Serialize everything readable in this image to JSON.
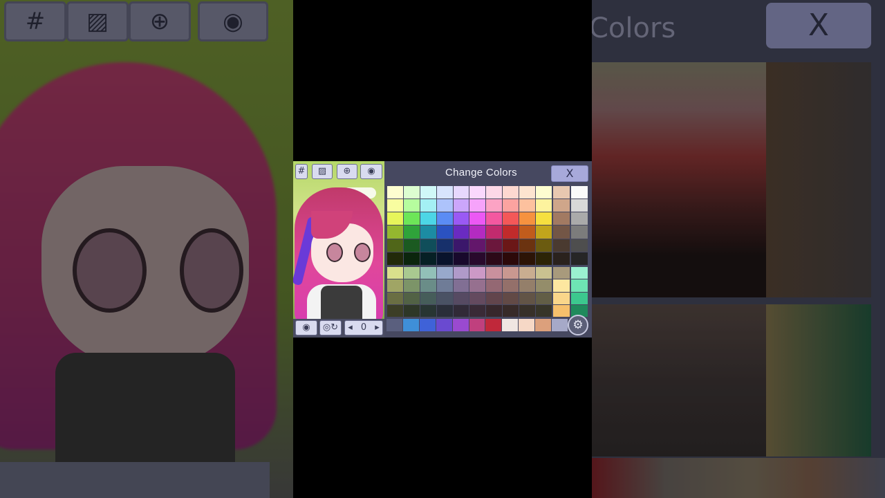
{
  "toolbar": {
    "hash_label": "#",
    "image_label": "▨",
    "zoom_label": "⊕",
    "eye_label": "◉"
  },
  "bottom_toolbar": {
    "eye_label": "◉",
    "reset_label": "◎↻",
    "prev_label": "◂",
    "next_label": "▸",
    "page_label": "0"
  },
  "panel": {
    "title": "Change Colors",
    "close_label": "X"
  },
  "gear_label": "⚙",
  "bg_right": {
    "title_fragment": "Colors",
    "close_label": "X"
  },
  "bg_left": {
    "hash_label": "#",
    "image_label": "▨",
    "zoom_label": "⊕",
    "eye_label": "◉"
  },
  "colors": {
    "accent": "#a7a9da",
    "panel_bg": "#464860",
    "title_text": "#f1f2fa"
  },
  "palette_main": [
    [
      "#fdfdd0",
      "#dcfdd0",
      "#d0f8f8",
      "#d8e4fd",
      "#e7d8fd",
      "#fad8fd",
      "#fdd8e7",
      "#fdd8d0",
      "#fde4d0",
      "#fdfdd0"
    ],
    [
      "#f8fda0",
      "#b6fd9e",
      "#a4f0f4",
      "#adc3fb",
      "#cba6fb",
      "#f6a3fb",
      "#fca3c4",
      "#fca3a0",
      "#fdc19e",
      "#fdf39e"
    ],
    [
      "#e7f55a",
      "#6de658",
      "#4cd6e6",
      "#5b8cf4",
      "#9a59f4",
      "#ec58f4",
      "#f458a0",
      "#f45858",
      "#f6923f",
      "#f6e03f"
    ],
    [
      "#94b72f",
      "#2fa33a",
      "#1c8ca3",
      "#2b52c1",
      "#6a2bc1",
      "#b42bc1",
      "#c12b6e",
      "#c12b2b",
      "#c15c1c",
      "#c1a51c"
    ],
    [
      "#506619",
      "#1b5a21",
      "#104e5a",
      "#17306b",
      "#3b176b",
      "#63176b",
      "#6b173c",
      "#6b1717",
      "#6b3310",
      "#6b5b10"
    ],
    [
      "#222a09",
      "#0b250d",
      "#062025",
      "#09132c",
      "#18092c",
      "#29092c",
      "#2c0918",
      "#2c0909",
      "#2c1406",
      "#2c2406"
    ]
  ],
  "palette_side1": [
    "#e8c8b0",
    "#cfa68a",
    "#a27a62",
    "#735646",
    "#4a3a30",
    "#2a221d"
  ],
  "palette_side2": [
    "#fafafa",
    "#d8d8d8",
    "#aaaaaa",
    "#7c7c7c",
    "#4e4e4e",
    "#262626"
  ],
  "palette_muted": [
    [
      "#d9e08c",
      "#a9c990",
      "#92c0b8",
      "#98a9cc",
      "#b09ac9",
      "#cc99c6",
      "#c9909d",
      "#c99890",
      "#c9ad90",
      "#c9c190"
    ],
    [
      "#a0a565",
      "#7c9468",
      "#6a8d88",
      "#6f7c97",
      "#816f94",
      "#96708f",
      "#946873",
      "#94706a",
      "#947f6a",
      "#948d6a"
    ],
    [
      "#6a6e43",
      "#526245",
      "#465d5a",
      "#4a5264",
      "#564a62",
      "#644a5f",
      "#62454c",
      "#624a46",
      "#625446",
      "#625e46"
    ],
    [
      "#3c3e26",
      "#2e3727",
      "#283533",
      "#2a2e39",
      "#312a37",
      "#392a36",
      "#37272b",
      "#372a28",
      "#373028",
      "#373528"
    ]
  ],
  "palette_muted_side1": [
    "#a89a7c",
    "#fde7a0",
    "#fad68a",
    "#f6c06c"
  ],
  "palette_muted_side2": [
    "#9af0d0",
    "#6ee4b4",
    "#3cc88e",
    "#1f8a5c"
  ],
  "palette_strip": [
    "#5a5f7e",
    "#3f8fd8",
    "#3f62d8",
    "#6a4ad0",
    "#9a4ad0",
    "#c0407e",
    "#c0283a",
    "#f0e6e2",
    "#f6d8c6",
    "#dca07c",
    "#a6a9c8"
  ]
}
